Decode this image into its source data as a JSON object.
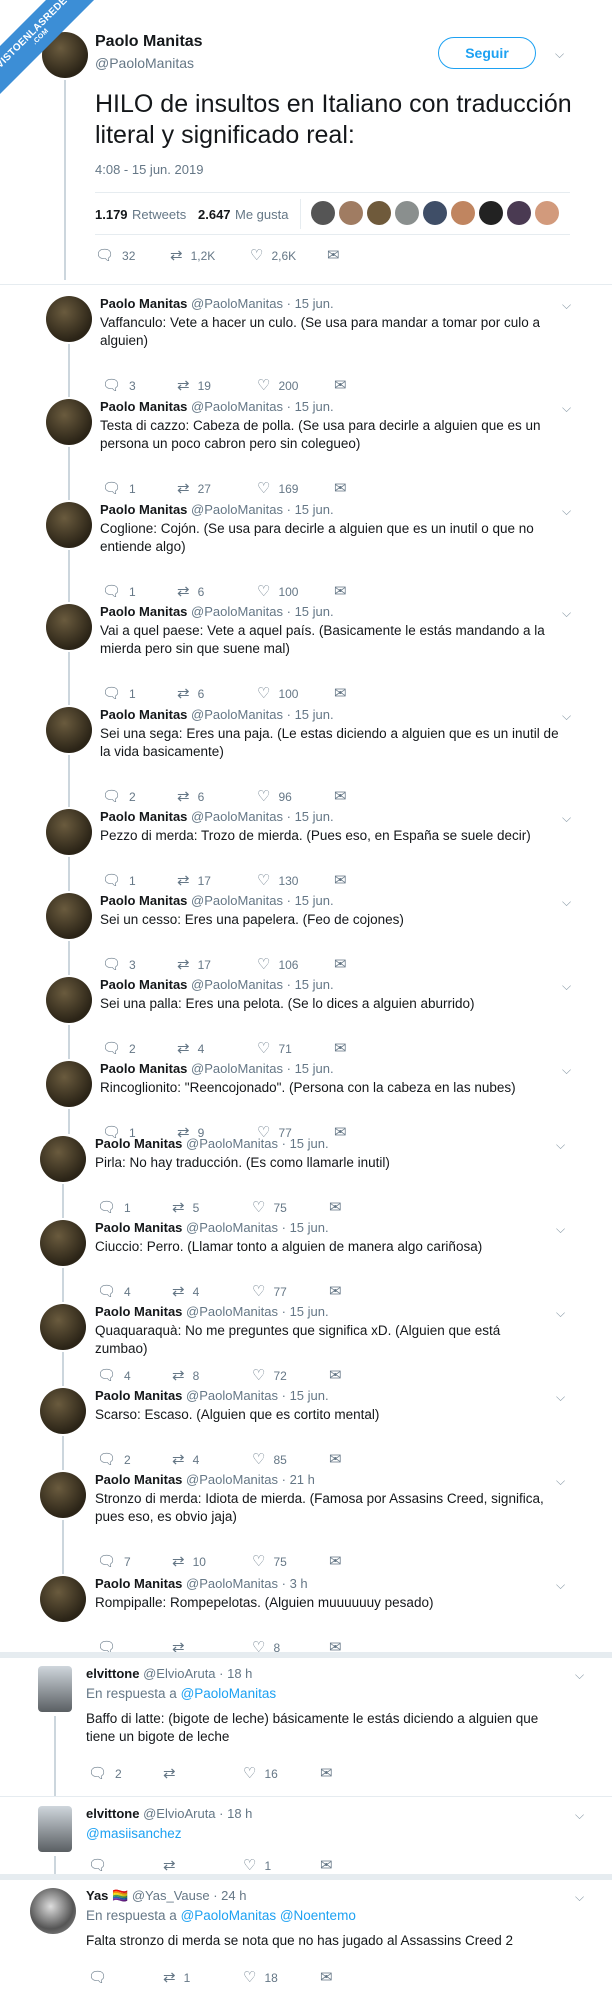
{
  "watermark": {
    "text": "VISTOENLASREDES",
    "sub": ".COM"
  },
  "main_tweet": {
    "name": "Paolo Manitas",
    "handle": "@PaoloManitas",
    "follow_label": "Seguir",
    "text": "HILO de insultos en Italiano con traducción literal y significado real:",
    "time": "4:08 - 15 jun. 2019",
    "retweets_num": "1.179",
    "retweets_label": "Retweets",
    "likes_num": "2.647",
    "likes_label": "Me gusta",
    "reply_count": "32",
    "retweet_count": "1,2K",
    "like_count": "2,6K"
  },
  "icons": {
    "reply": "reply-icon",
    "retweet": "retweet-icon",
    "like": "heart-icon",
    "dm": "envelope-icon",
    "chevron": "chevron-down-icon"
  },
  "colors": {
    "accent": "#1da1f2",
    "muted": "#657786",
    "border": "#e6ecf0",
    "watermark": "#3c8ed6"
  },
  "thread": [
    {
      "name": "Paolo Manitas",
      "handle": "@PaoloManitas",
      "time": "· 15 jun.",
      "text": "Vaffanculo: Vete a hacer un culo. (Se usa para mandar a tomar por culo a alguien)",
      "replies": "3",
      "retweets": "19",
      "likes": "200"
    },
    {
      "name": "Paolo Manitas",
      "handle": "@PaoloManitas",
      "time": "· 15 jun.",
      "text": "Testa di cazzo: Cabeza de polla. (Se usa para decirle a alguien que es un persona un poco cabron pero sin colegueo)",
      "replies": "1",
      "retweets": "27",
      "likes": "169"
    },
    {
      "name": "Paolo Manitas",
      "handle": "@PaoloManitas",
      "time": "· 15 jun.",
      "text": "Coglione: Cojón. (Se usa para decirle a alguien que es un inutil o que no entiende algo)",
      "replies": "1",
      "retweets": "6",
      "likes": "100"
    },
    {
      "name": "Paolo Manitas",
      "handle": "@PaoloManitas",
      "time": "· 15 jun.",
      "text": "Vai a quel paese: Vete a aquel país. (Basicamente le estás mandando a la mierda pero sin que suene mal)",
      "replies": "1",
      "retweets": "6",
      "likes": "100"
    },
    {
      "name": "Paolo Manitas",
      "handle": "@PaoloManitas",
      "time": "· 15 jun.",
      "text": "Sei una sega: Eres una paja. (Le estas diciendo a alguien que es un inutil de la vida basicamente)",
      "replies": "2",
      "retweets": "6",
      "likes": "96"
    },
    {
      "name": "Paolo Manitas",
      "handle": "@PaoloManitas",
      "time": "· 15 jun.",
      "text": "Pezzo di merda: Trozo de mierda. (Pues eso, en España se suele decir)",
      "replies": "1",
      "retweets": "17",
      "likes": "130"
    },
    {
      "name": "Paolo Manitas",
      "handle": "@PaoloManitas",
      "time": "· 15 jun.",
      "text": "Sei un cesso: Eres una papelera. (Feo de cojones)",
      "replies": "3",
      "retweets": "17",
      "likes": "106"
    },
    {
      "name": "Paolo Manitas",
      "handle": "@PaoloManitas",
      "time": "· 15 jun.",
      "text": "Sei una palla: Eres una pelota. (Se lo dices a alguien aburrido)",
      "replies": "2",
      "retweets": "4",
      "likes": "71"
    },
    {
      "name": "Paolo Manitas",
      "handle": "@PaoloManitas",
      "time": "· 15 jun.",
      "text": "Rincoglionito: \"Reencojonado\". (Persona con la cabeza en las nubes)",
      "replies": "1",
      "retweets": "9",
      "likes": "77"
    },
    {
      "name": "Paolo Manitas",
      "handle": "@PaoloManitas",
      "time": "· 15 jun.",
      "text": "Pirla: No hay traducción. (Es como llamarle inutil)",
      "replies": "1",
      "retweets": "5",
      "likes": "75"
    },
    {
      "name": "Paolo Manitas",
      "handle": "@PaoloManitas",
      "time": "· 15 jun.",
      "text": "Ciuccio: Perro. (Llamar tonto a alguien de manera algo cariñosa)",
      "replies": "4",
      "retweets": "4",
      "likes": "77"
    },
    {
      "name": "Paolo Manitas",
      "handle": "@PaoloManitas",
      "time": "· 15 jun.",
      "text": "Quaquaraquà: No me preguntes que significa xD. (Alguien que está zumbao)",
      "replies": "4",
      "retweets": "8",
      "likes": "72"
    },
    {
      "name": "Paolo Manitas",
      "handle": "@PaoloManitas",
      "time": "· 15 jun.",
      "text": "Scarso: Escaso. (Alguien que es cortito mental)",
      "replies": "2",
      "retweets": "4",
      "likes": "85"
    },
    {
      "name": "Paolo Manitas",
      "handle": "@PaoloManitas",
      "time": "· 21 h",
      "text": "Stronzo di merda: Idiota de mierda. (Famosa por Assasins Creed, significa, pues eso, es obvio jaja)",
      "replies": "7",
      "retweets": "10",
      "likes": "75"
    },
    {
      "name": "Paolo Manitas",
      "handle": "@PaoloManitas",
      "time": "· 3 h",
      "text": "Rompipalle: Rompepelotas. (Alguien muuuuuuy pesado)",
      "replies": "",
      "retweets": "",
      "likes": "8"
    }
  ],
  "replies": [
    {
      "name": "elvittone",
      "handle": "@ElvioAruta",
      "time": "· 18 h",
      "reply_prefix": "En respuesta a",
      "reply_to": "@PaoloManitas",
      "text": "Baffo di latte: (bigote de leche) básicamente le estás diciendo a alguien que tiene un bigote de leche",
      "replies": "2",
      "retweets": "",
      "likes": "16"
    },
    {
      "name": "elvittone",
      "handle": "@ElvioAruta",
      "time": "· 18 h",
      "mention": "@masiisanchez",
      "replies": "",
      "retweets": "",
      "likes": "1"
    },
    {
      "name": "Yas 🏳️‍🌈",
      "handle": "@Yas_Vause",
      "time": "· 24 h",
      "reply_prefix": "En respuesta a",
      "reply_to": "@PaoloManitas @Noentemo",
      "text": "Falta stronzo di merda se nota que no has jugado al Assassins Creed 2",
      "replies": "",
      "retweets": "1",
      "likes": "18"
    }
  ]
}
